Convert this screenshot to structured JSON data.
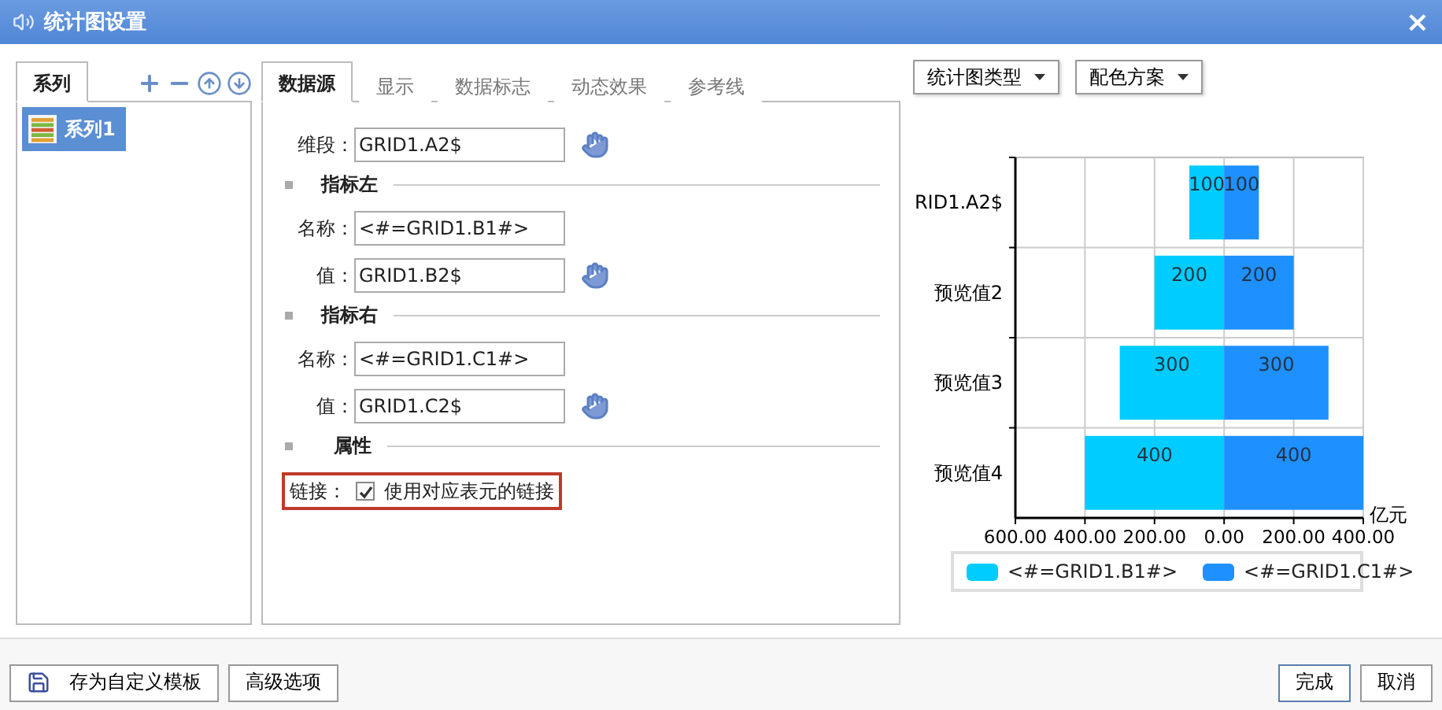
{
  "window": {
    "title": "统计图设置",
    "close": "×"
  },
  "series_panel": {
    "tab": {
      "label": "系列",
      "selected": true
    },
    "items": [
      {
        "label": "系列1",
        "selected": true
      }
    ]
  },
  "tabs": [
    {
      "label": "数据源",
      "selected": true
    },
    {
      "label": "显示",
      "selected": false
    },
    {
      "label": "数据标志",
      "selected": false
    },
    {
      "label": "动态效果",
      "selected": false
    },
    {
      "label": "参考线",
      "selected": false
    }
  ],
  "data_source": {
    "dimension": {
      "label": "维段：",
      "value": "GRID1.A2$"
    },
    "sections": [
      {
        "title": "指标左",
        "fields": [
          {
            "label": "名称：",
            "value": "<#=GRID1.B1#>",
            "kind": "text"
          },
          {
            "label": "值：",
            "value": "GRID1.B2$",
            "kind": "picker"
          }
        ]
      },
      {
        "title": "指标右",
        "fields": [
          {
            "label": "名称：",
            "value": "<#=GRID1.C1#>",
            "kind": "text"
          },
          {
            "label": "值：",
            "value": "GRID1.C2$",
            "kind": "picker"
          }
        ]
      }
    ],
    "attributes": {
      "title": "属性",
      "link": {
        "label": "链接：",
        "checked": true,
        "text": "使用对应表元的链接",
        "highlighted": true
      }
    }
  },
  "chart_toolbar": [
    "统计图类型",
    "配色方案"
  ],
  "chart": {
    "chart_data": {
      "type": "bar",
      "orientation": "horizontal",
      "stacked": true,
      "xlabel": "亿元",
      "categories": [
        "RID1.A2$",
        "预览值2",
        "预览值3",
        "预览值4"
      ],
      "series": [
        {
          "name": "<#=GRID1.B1#>",
          "color": "#00ccff",
          "values": [
            -100,
            -200,
            -300,
            -400
          ]
        },
        {
          "name": "<#=GRID1.C1#>",
          "color": "#1e90ff",
          "values": [
            100,
            200,
            300,
            400
          ]
        }
      ],
      "xlim": [
        -600,
        400
      ],
      "xticks": [
        {
          "value": -600,
          "label": "600.00"
        },
        {
          "value": -400,
          "label": "400.00"
        },
        {
          "value": -200,
          "label": "200.00"
        },
        {
          "value": 0,
          "label": "0.00"
        },
        {
          "value": 200,
          "label": "200.00"
        },
        {
          "value": 400,
          "label": "400.00"
        }
      ],
      "grid": true,
      "value_labels": [
        [
          "100",
          "200",
          "300",
          "400"
        ],
        [
          "100",
          "200",
          "300",
          "400"
        ]
      ]
    }
  },
  "footer": {
    "left_buttons": [
      {
        "label": "存为自定义模板",
        "kind": "save"
      },
      {
        "label": "高级选项",
        "kind": "plain"
      }
    ],
    "right_buttons": [
      {
        "label": "完成",
        "primary": true
      },
      {
        "label": "取消",
        "primary": false
      }
    ]
  }
}
